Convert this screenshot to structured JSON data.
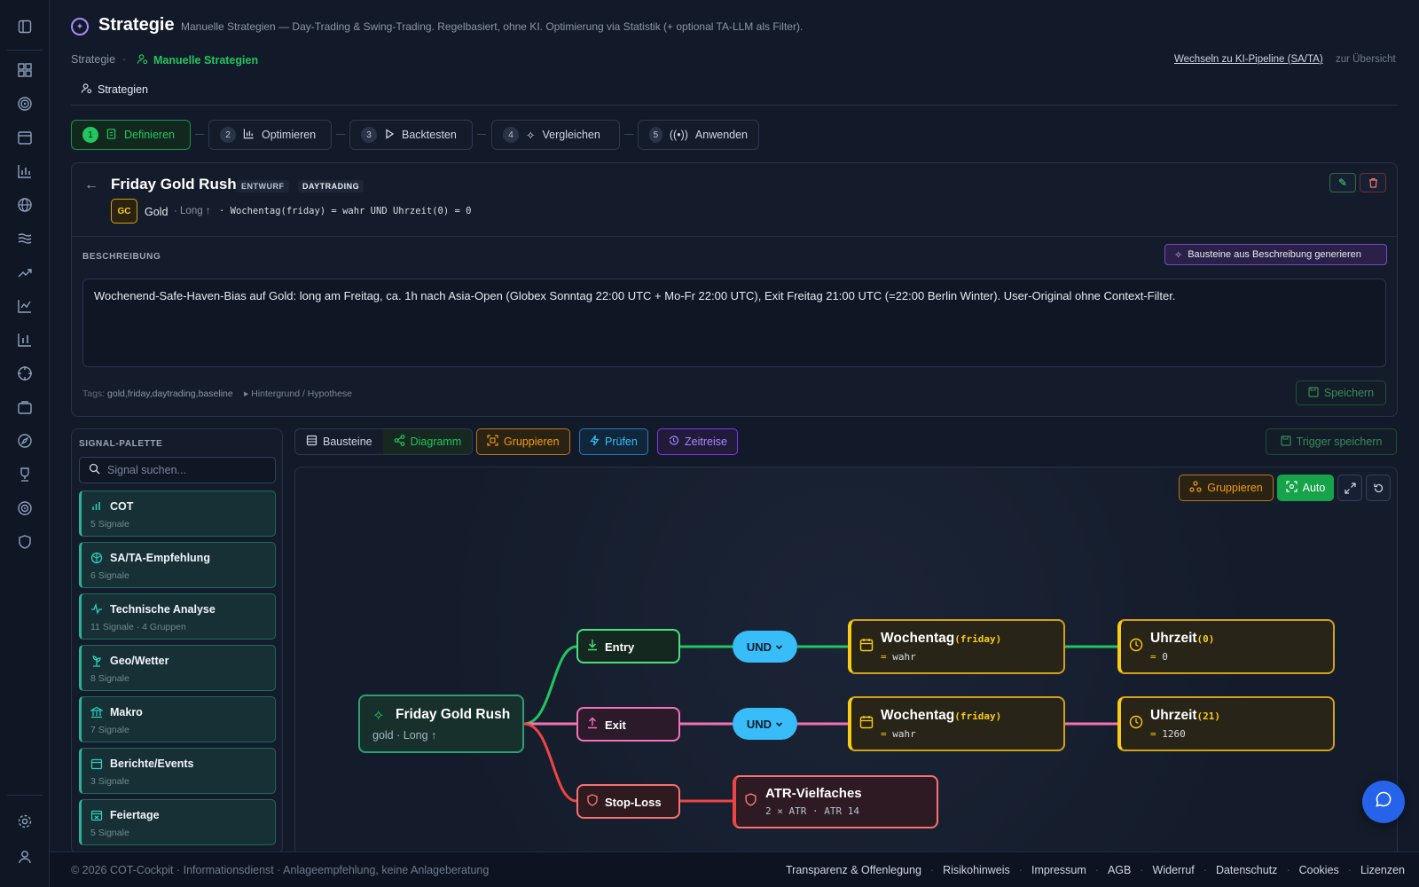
{
  "header": {
    "title": "Strategie",
    "subtitle": "Manuelle Strategien — Day-Trading & Swing-Trading. Regelbasiert, ohne KI. Optimierung via Statistik (+ optional TA-LLM als Filter).",
    "breadcrumb_root": "Strategie",
    "breadcrumb_current": "Manuelle Strategien",
    "switch_link": "Wechseln zu KI-Pipeline (SA/TA)",
    "overview_link": "zur Übersicht",
    "tab": "Strategien"
  },
  "steps": [
    {
      "num": "1",
      "label": "Definieren"
    },
    {
      "num": "2",
      "label": "Optimieren"
    },
    {
      "num": "3",
      "label": "Backtesten"
    },
    {
      "num": "4",
      "label": "Vergleichen"
    },
    {
      "num": "5",
      "label": "Anwenden"
    }
  ],
  "strategy": {
    "name": "Friday Gold Rush",
    "badge_status": "ENTWURF",
    "badge_type": "DAYTRADING",
    "asset_code": "GC",
    "asset_name": "Gold",
    "direction": "· Long ↑",
    "rule_summary": "· Wochentag(friday) = wahr UND Uhrzeit(0) = 0",
    "description_label": "BESCHREIBUNG",
    "generate_button": "Bausteine aus Beschreibung generieren",
    "description": "Wochenend-Safe-Haven-Bias auf Gold: long am Freitag, ca. 1h nach Asia-Open (Globex Sonntag 22:00 UTC + Mo-Fr 22:00 UTC), Exit Freitag 21:00 UTC (=22:00 Berlin Winter). User-Original ohne Context-Filter.",
    "tags_label": "Tags:",
    "tags": "gold,friday,daytrading,baseline",
    "background_toggle": "▸ Hintergrund / Hypothese",
    "save_button": "Speichern"
  },
  "palette": {
    "title": "SIGNAL-PALETTE",
    "search_placeholder": "Signal suchen...",
    "items": [
      {
        "name": "COT",
        "sub": "5 Signale",
        "icon": "chart-bar-icon"
      },
      {
        "name": "SA/TA-Empfehlung",
        "sub": "6 Signale",
        "icon": "brain-icon"
      },
      {
        "name": "Technische Analyse",
        "sub": "11 Signale · 4 Gruppen",
        "icon": "pulse-icon"
      },
      {
        "name": "Geo/Wetter",
        "sub": "8 Signale",
        "icon": "plant-icon"
      },
      {
        "name": "Makro",
        "sub": "7 Signale",
        "icon": "bank-icon"
      },
      {
        "name": "Berichte/Events",
        "sub": "3 Signale",
        "icon": "calendar-icon"
      },
      {
        "name": "Feiertage",
        "sub": "5 Signale",
        "icon": "calendar-x-icon"
      }
    ]
  },
  "toolbar": {
    "view_blocks": "Bausteine",
    "view_diagram": "Diagramm",
    "group": "Gruppieren",
    "check": "Prüfen",
    "timetravel": "Zeitreise",
    "save_trigger": "Trigger speichern"
  },
  "canvas": {
    "group": "Gruppieren",
    "auto": "Auto"
  },
  "diagram": {
    "root_title": "Friday Gold Rush",
    "root_sub": "gold · Long ↑",
    "entry": "Entry",
    "exit": "Exit",
    "stop": "Stop-Loss",
    "and_label": "UND",
    "entry_cond1_name": "Wochentag",
    "entry_cond1_arg": "(friday)",
    "entry_cond1_val": "wahr",
    "entry_cond2_name": "Uhrzeit",
    "entry_cond2_arg": "(0)",
    "entry_cond2_val": "0",
    "exit_cond1_name": "Wochentag",
    "exit_cond1_arg": "(friday)",
    "exit_cond1_val": "wahr",
    "exit_cond2_name": "Uhrzeit",
    "exit_cond2_arg": "(21)",
    "exit_cond2_val": "1260",
    "eq_sign": "=",
    "atr_title": "ATR-Vielfaches",
    "atr_sub": "2 × ATR · ATR 14"
  },
  "footer": {
    "copyright": "© 2026 COT-Cockpit · Informationsdienst · Anlageempfehlung, keine Anlageberatung",
    "links": [
      "Transparenz & Offenlegung",
      "Risikohinweis",
      "Impressum",
      "AGB",
      "Widerruf",
      "Datenschutz",
      "Cookies",
      "Lizenzen"
    ]
  },
  "colors": {
    "accent_green": "#22c55e",
    "accent_gold": "#facc15",
    "accent_pink": "#f472b6",
    "accent_red": "#f87171",
    "accent_blue": "#38bdf8",
    "accent_purple": "#a78bfa"
  }
}
